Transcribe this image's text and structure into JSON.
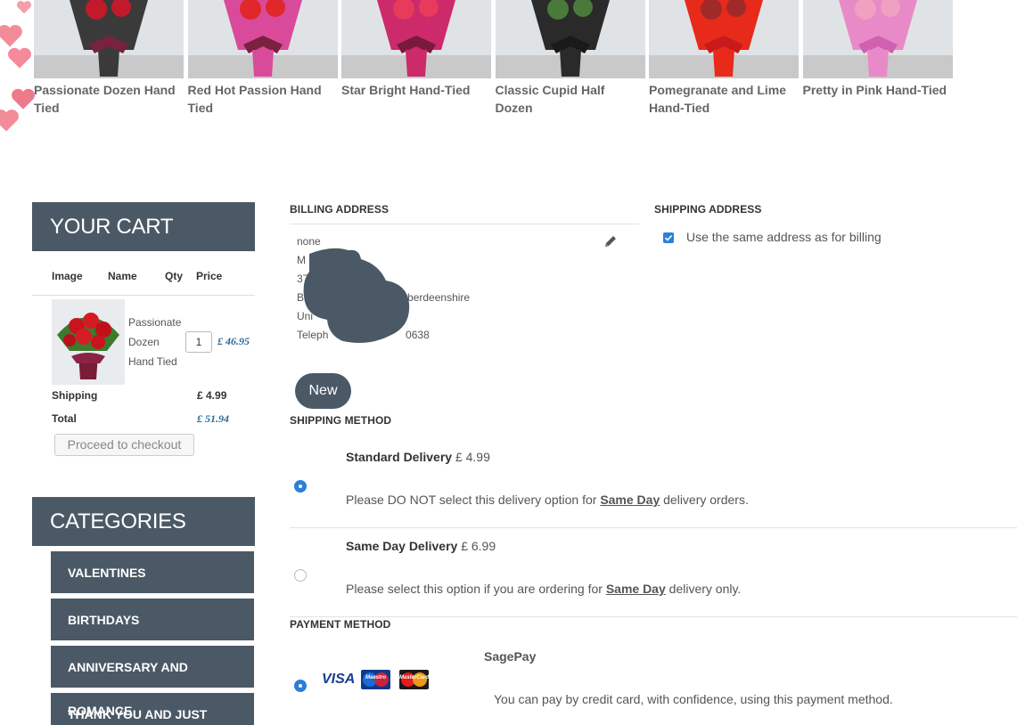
{
  "products": [
    {
      "name": "Passionate Dozen Hand Tied",
      "wrap": "#3a3a3a",
      "bow": "#7a2040",
      "flower": "#c21a2a"
    },
    {
      "name": "Red Hot Passion Hand Tied",
      "wrap": "#d94a9a",
      "bow": "#7a2040",
      "flower": "#e0282a"
    },
    {
      "name": "Star Bright Hand-Tied",
      "wrap": "#cc2a6a",
      "bow": "#7a1a3a",
      "flower": "#e83a5a"
    },
    {
      "name": "Classic Cupid Half Dozen",
      "wrap": "#2a2a2a",
      "bow": "#1a1a1a",
      "flower": "#4a7a3a"
    },
    {
      "name": "Pomegranate and Lime Hand-Tied",
      "wrap": "#e82a1a",
      "bow": "#c81a1a",
      "flower": "#a02a2a"
    },
    {
      "name": "Pretty in Pink Hand-Tied",
      "wrap": "#e88ac8",
      "bow": "#d060b0",
      "flower": "#f0a0c0"
    }
  ],
  "cart": {
    "title": "YOUR CART",
    "headers": {
      "image": "Image",
      "name": "Name",
      "qty": "Qty",
      "price": "Price"
    },
    "item": {
      "name": "Passionate Dozen Hand Tied",
      "qty": "1",
      "price": "£ 46.95"
    },
    "shipping_label": "Shipping",
    "shipping_value": "£ 4.99",
    "total_label": "Total",
    "total_value": "£ 51.94",
    "checkout_label": "Proceed to checkout"
  },
  "categories": {
    "title": "CATEGORIES",
    "items": [
      "VALENTINES",
      "BIRTHDAYS",
      "ANNIVERSARY AND ROMANCE",
      "THANK YOU AND JUST"
    ]
  },
  "billing": {
    "label": "BILLING ADDRESS",
    "lines": [
      "none",
      "M          ter",
      "37          1",
      "BH                              Aberdeenshire",
      "Uni",
      "Teleph                          0638"
    ],
    "new_button": "New"
  },
  "shipping_address": {
    "label": "SHIPPING ADDRESS",
    "same_as_billing": "Use the same address as for billing",
    "checked": true
  },
  "shipping_method": {
    "label": "SHIPPING METHOD",
    "options": [
      {
        "title": "Standard Delivery",
        "price": "£ 4.99",
        "desc_pre": "Please DO NOT select this delivery option for ",
        "desc_em": "Same Day",
        "desc_post": " delivery orders.",
        "selected": true
      },
      {
        "title": "Same Day Delivery",
        "price": "£ 6.99",
        "desc_pre": "Please select this option if you are ordering for ",
        "desc_em": "Same Day",
        "desc_post": " delivery only.",
        "selected": false
      }
    ]
  },
  "payment_method": {
    "label": "PAYMENT METHOD",
    "name": "SagePay",
    "visa": "VISA",
    "maestro": "Maestro",
    "mastercard": "MasterCard",
    "desc": "You can pay by credit card, with confidence, using this payment method."
  },
  "colors": {
    "panel": "#4b5966",
    "accent": "#2b7fd8",
    "price": "#2a6a9a",
    "heart": "#f08090"
  }
}
